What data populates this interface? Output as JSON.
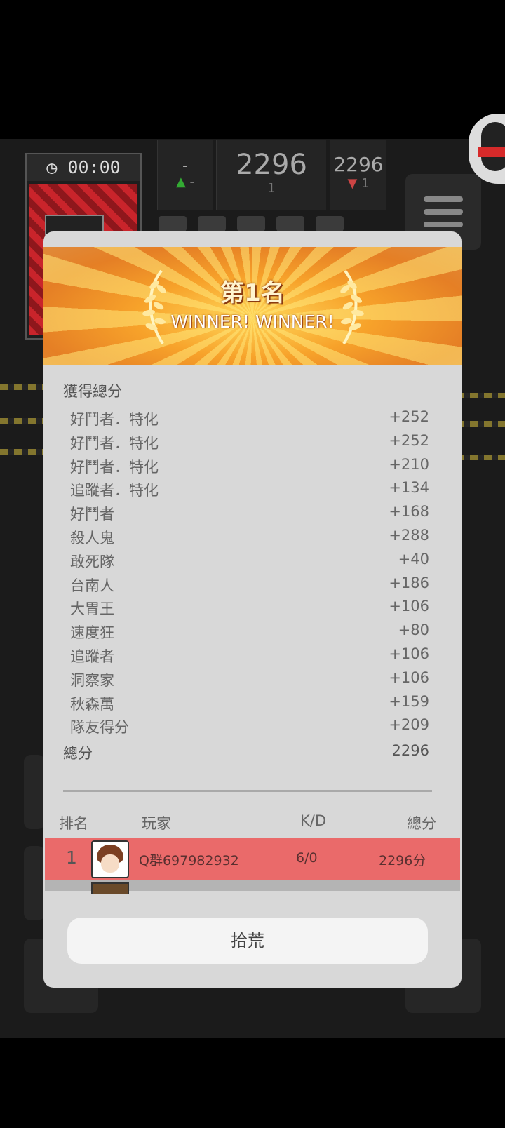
{
  "hud": {
    "timer": "00:00",
    "stats": [
      {
        "big": "-",
        "small": "-",
        "arrow": "▲"
      },
      {
        "big": "2296",
        "small": "1",
        "arrow": ""
      },
      {
        "big": "2296",
        "small": "1",
        "arrow": "▼"
      }
    ]
  },
  "result": {
    "rank_title": "第1名",
    "subtitle": "WINNER! WINNER!",
    "score_heading": "獲得總分",
    "score_items": [
      {
        "label": "好鬥者．特化",
        "value": "+252"
      },
      {
        "label": "好鬥者．特化",
        "value": "+252"
      },
      {
        "label": "好鬥者．特化",
        "value": "+210"
      },
      {
        "label": "追蹤者．特化",
        "value": "+134"
      },
      {
        "label": "好鬥者",
        "value": "+168"
      },
      {
        "label": "殺人鬼",
        "value": "+288"
      },
      {
        "label": "敢死隊",
        "value": "+40"
      },
      {
        "label": "台南人",
        "value": "+186"
      },
      {
        "label": "大胃王",
        "value": "+106"
      },
      {
        "label": "速度狂",
        "value": "+80"
      },
      {
        "label": "追蹤者",
        "value": "+106"
      },
      {
        "label": "洞察家",
        "value": "+106"
      },
      {
        "label": "秋森萬",
        "value": "+159"
      },
      {
        "label": "隊友得分",
        "value": "+209"
      }
    ],
    "total_label": "總分",
    "total_value": "2296"
  },
  "ranking": {
    "headers": {
      "rank": "排名",
      "player": "玩家",
      "kd": "K/D",
      "score": "總分"
    },
    "rows": [
      {
        "rank": "1",
        "player": "Q群697982932",
        "kd": "6/0",
        "score": "2296分"
      }
    ]
  },
  "actions": {
    "scrap_label": "拾荒"
  },
  "colors": {
    "highlight_row": "#ea6a6a",
    "modal_bg": "#d8d8d8",
    "banner": "#f7a22a"
  }
}
